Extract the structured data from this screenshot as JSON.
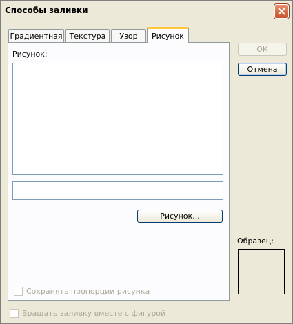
{
  "window": {
    "title": "Способы заливки"
  },
  "tabs": [
    {
      "label": "Градиентная",
      "active": false
    },
    {
      "label": "Текстура",
      "active": false
    },
    {
      "label": "Узор",
      "active": false
    },
    {
      "label": "Рисунок",
      "active": true
    }
  ],
  "picture_tab": {
    "picture_label": "Рисунок:",
    "picture_name_value": "",
    "picture_button": "Рисунок...",
    "keep_ratio_label": "Сохранять пропорции рисунка"
  },
  "buttons": {
    "ok": "ОК",
    "cancel": "Отмена"
  },
  "sample_label": "Образец:",
  "rotate_label": "Вращать заливку вместе с фигурой",
  "colors": {
    "dialog_bg": "#ece9d8",
    "close_button": "#c8532a",
    "active_tab_accent": "#ffc83c"
  }
}
